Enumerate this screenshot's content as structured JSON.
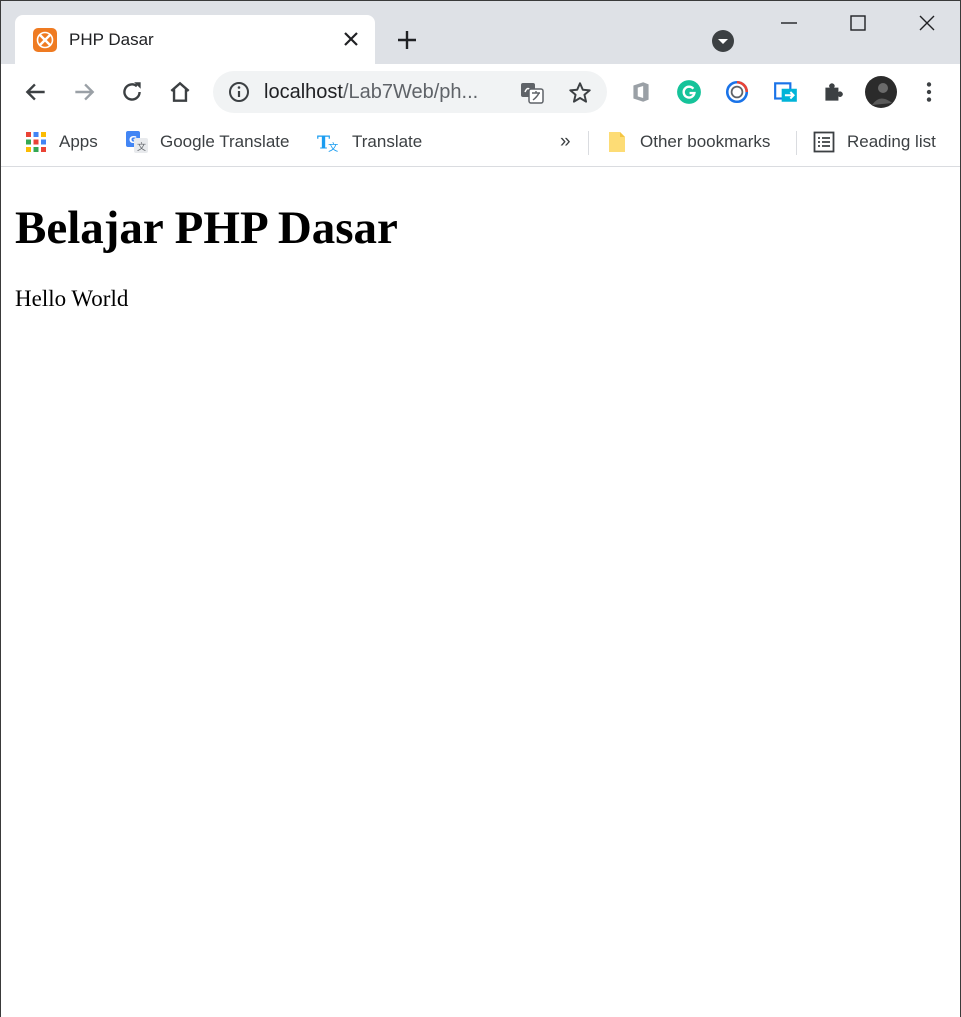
{
  "browser": {
    "tab": {
      "title": "PHP Dasar",
      "favicon": "xampp-icon"
    },
    "omnibox": {
      "host": "localhost",
      "path": "/Lab7Web/ph..."
    },
    "bookmarks": [
      {
        "label": "Apps",
        "icon": "apps-grid-icon"
      },
      {
        "label": "Google Translate",
        "icon": "google-translate-icon"
      },
      {
        "label": "Translate",
        "icon": "translate-icon"
      }
    ],
    "overflow_label": "»",
    "other_bookmarks": "Other bookmarks",
    "reading_list": "Reading list",
    "colors": {
      "tabstrip": "#dee1e6",
      "omnibox": "#f1f3f4",
      "accent_orange": "#ef7b22"
    }
  },
  "page": {
    "heading": "Belajar PHP Dasar",
    "paragraph": "Hello World"
  }
}
